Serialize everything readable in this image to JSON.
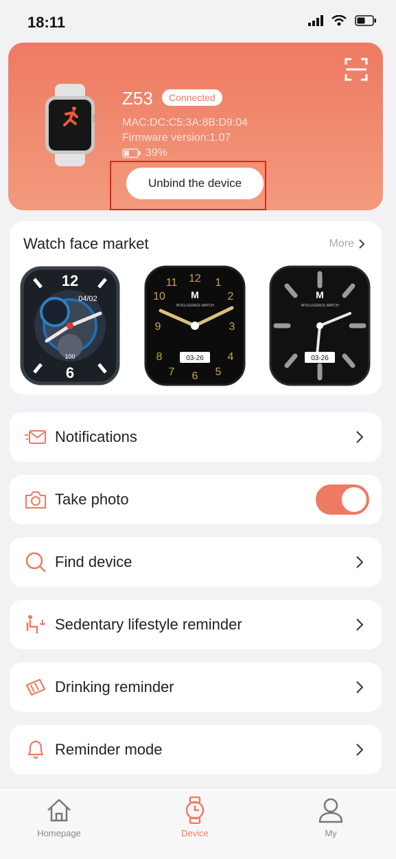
{
  "status_bar": {
    "time": "18:11"
  },
  "device": {
    "name": "Z53",
    "status": "Connected",
    "mac": "MAC:DC:C5:3A:8B:D9:04",
    "firmware": "Firmware version:1.07",
    "battery": "39%",
    "battery_level": 0.39,
    "unbind_label": "Unbind the device"
  },
  "watch_face_market": {
    "title": "Watch face market",
    "more": "More",
    "faces": [
      {
        "hour_top": "12",
        "hour_bottom": "6",
        "date": "04/02",
        "extra": "100"
      },
      {
        "numerals": [
          "12",
          "1",
          "2",
          "3",
          "4",
          "5",
          "6",
          "7",
          "8",
          "9",
          "10",
          "11"
        ],
        "date": "03-26",
        "brand": "INTELLIGENCE WATCH"
      },
      {
        "date": "03-26",
        "brand": "INTELLIGENCE WATCH"
      }
    ]
  },
  "menu": {
    "notifications": "Notifications",
    "take_photo": "Take photo",
    "take_photo_on": true,
    "find_device": "Find device",
    "sedentary": "Sedentary lifestyle reminder",
    "drinking": "Drinking reminder",
    "reminder_mode": "Reminder mode"
  },
  "tabs": [
    {
      "label": "Homepage",
      "icon": "home-icon"
    },
    {
      "label": "Device",
      "icon": "watch-icon",
      "active": true
    },
    {
      "label": "My",
      "icon": "user-icon"
    }
  ],
  "colors": {
    "accent": "#ee7a62",
    "highlight": "#e3231b",
    "background": "#f2f2f4"
  }
}
